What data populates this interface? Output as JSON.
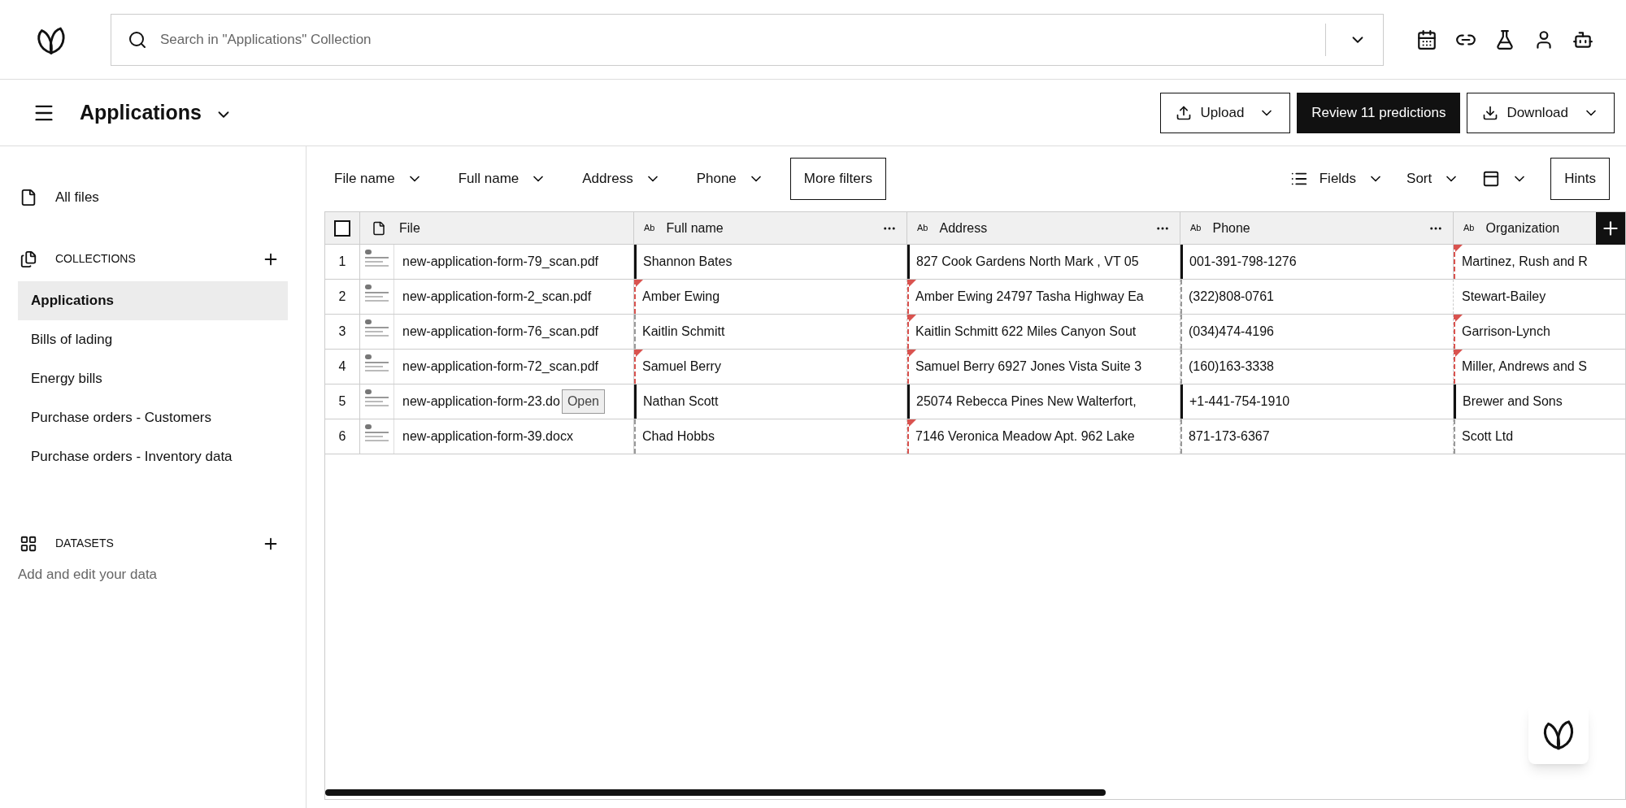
{
  "search": {
    "placeholder": "Search in \"Applications\" Collection"
  },
  "header": {
    "title": "Applications",
    "buttons": [
      {
        "label": "Upload",
        "kind": "upload"
      },
      {
        "label": "Review 11 predictions",
        "kind": "primary"
      },
      {
        "label": "Download",
        "kind": "download"
      }
    ]
  },
  "sidebar": {
    "all_files": "All files",
    "collections_heading": "COLLECTIONS",
    "collections": [
      {
        "label": "Applications",
        "selected": true
      },
      {
        "label": "Bills of lading",
        "selected": false
      },
      {
        "label": "Energy bills",
        "selected": false
      },
      {
        "label": "Purchase orders - Customers",
        "selected": false
      },
      {
        "label": "Purchase orders - Inventory data",
        "selected": false
      }
    ],
    "datasets_heading": "DATASETS",
    "datasets_hint": "Add and edit your data"
  },
  "filters": [
    "File name",
    "Full name",
    "Address",
    "Phone"
  ],
  "more_filters": "More filters",
  "view_controls": [
    {
      "label": "Fields",
      "kind": "fields"
    },
    {
      "label": "Sort",
      "kind": "sort"
    },
    {
      "kind": "layout"
    }
  ],
  "hints": "Hints",
  "table": {
    "select_all": {
      "checked": false
    },
    "file_column": "File",
    "columns": [
      {
        "type": "Ab",
        "label": "Full name"
      },
      {
        "type": "Ab",
        "label": "Address"
      },
      {
        "type": "Ab",
        "label": "Phone"
      },
      {
        "type": "Ab",
        "label": "Organization"
      }
    ],
    "rows": [
      {
        "index": "1",
        "file": "new-application-form-79_scan.pdf",
        "cells": [
          {
            "text": "Shannon Bates",
            "kind": "confirmed"
          },
          {
            "text": "827 Cook Gardens North Mark , VT 05",
            "kind": "confirmed"
          },
          {
            "text": "001-391-798-1276",
            "kind": "confirmed"
          },
          {
            "text": "Martinez, Rush and R",
            "kind": "predicted"
          }
        ]
      },
      {
        "index": "2",
        "file": "new-application-form-2_scan.pdf",
        "cells": [
          {
            "text": "Amber Ewing",
            "kind": "predicted"
          },
          {
            "text": "Amber Ewing 24797 Tasha Highway Ea",
            "kind": "predicted"
          },
          {
            "text": "(322)808-0761",
            "kind": "pending"
          },
          {
            "text": "Stewart-Bailey",
            "kind": "plain"
          }
        ]
      },
      {
        "index": "3",
        "file": "new-application-form-76_scan.pdf",
        "cells": [
          {
            "text": "Kaitlin Schmitt",
            "kind": "pending"
          },
          {
            "text": "Kaitlin Schmitt 622 Miles Canyon Sout",
            "kind": "predicted"
          },
          {
            "text": "(034)474-4196",
            "kind": "pending"
          },
          {
            "text": "Garrison-Lynch",
            "kind": "predicted"
          }
        ]
      },
      {
        "index": "4",
        "file": "new-application-form-72_scan.pdf",
        "cells": [
          {
            "text": "Samuel Berry",
            "kind": "predicted"
          },
          {
            "text": "Samuel Berry 6927 Jones Vista Suite 3",
            "kind": "predicted"
          },
          {
            "text": "(160)163-3338",
            "kind": "pending"
          },
          {
            "text": "Miller, Andrews and S",
            "kind": "predicted"
          }
        ]
      },
      {
        "index": "5",
        "file": "new-application-form-23.do",
        "tooltip": "Open",
        "cells": [
          {
            "text": "Nathan Scott",
            "kind": "confirmed"
          },
          {
            "text": "25074 Rebecca Pines New Walterfort,",
            "kind": "confirmed"
          },
          {
            "text": "+1-441-754-1910",
            "kind": "confirmed"
          },
          {
            "text": "Brewer and Sons",
            "kind": "confirmed"
          }
        ]
      },
      {
        "index": "6",
        "file": "new-application-form-39.docx",
        "cells": [
          {
            "text": "Chad Hobbs",
            "kind": "pending"
          },
          {
            "text": "7146 Veronica Meadow Apt. 962 Lake",
            "kind": "predicted"
          },
          {
            "text": "871-173-6367",
            "kind": "pending"
          },
          {
            "text": "Scott Ltd",
            "kind": "pending"
          }
        ]
      }
    ]
  }
}
